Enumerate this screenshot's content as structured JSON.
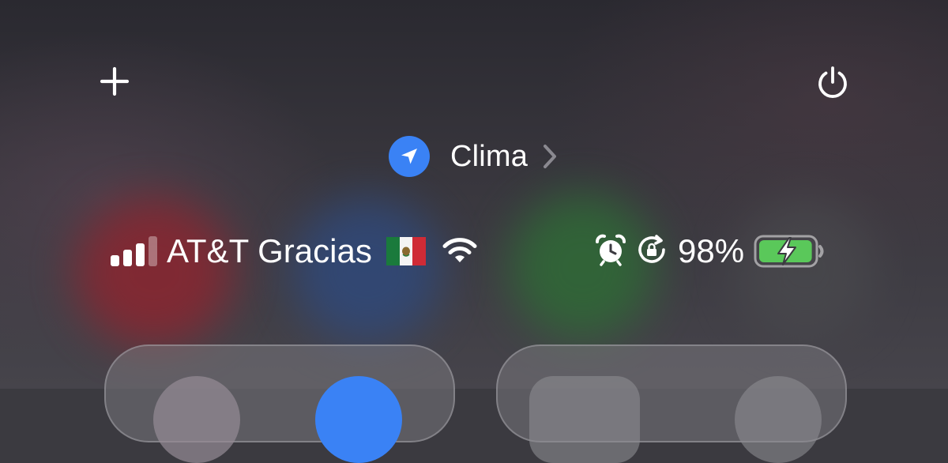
{
  "header": {
    "add_icon": "plus-icon",
    "power_icon": "power-icon"
  },
  "location": {
    "icon": "location-arrow-icon",
    "label": "Clima",
    "chevron": "chevron-right-icon",
    "accent": "#3a82f5"
  },
  "status_bar": {
    "signal_bars_filled": 3,
    "signal_bars_total": 4,
    "carrier": "AT&T Gracias",
    "flag_icon": "mexico-flag-icon",
    "wifi_icon": "wifi-icon",
    "alarm_icon": "alarm-clock-icon",
    "rotation_lock_icon": "rotation-lock-icon",
    "battery_percent": "98%",
    "battery_level": 0.98,
    "battery_charging": true,
    "battery_color": "#5ac85a"
  }
}
